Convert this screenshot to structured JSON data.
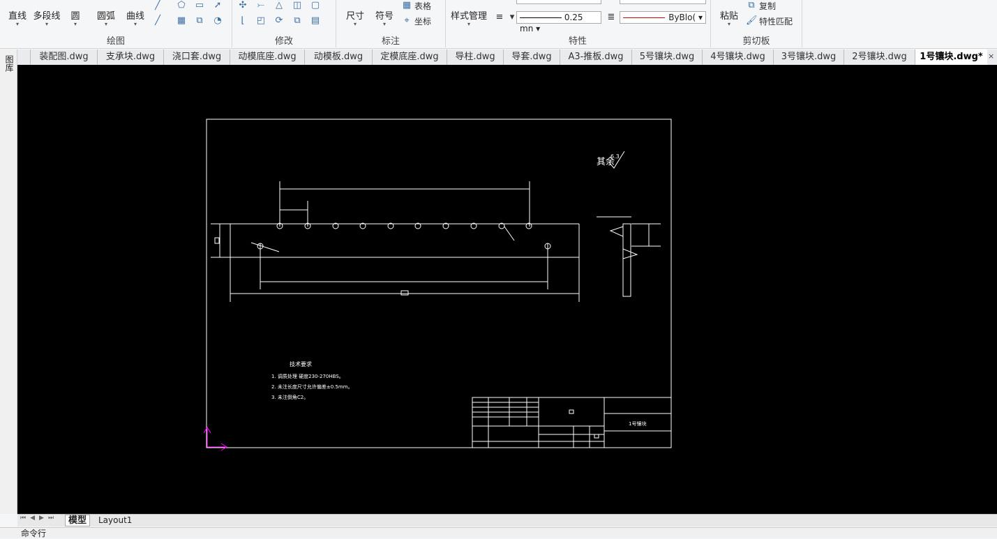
{
  "ribbon": {
    "draw": {
      "title": "绘图",
      "line": "直线",
      "polyline": "多段线",
      "circle": "圆",
      "arc": "圆弧",
      "curve": "曲线"
    },
    "modify": {
      "title": "修改"
    },
    "annotate": {
      "title": "标注",
      "dimension": "尺寸",
      "symbol": "符号",
      "table": "表格",
      "coord": "坐标"
    },
    "style": {
      "label": "样式管理"
    },
    "props": {
      "title": "特性",
      "lineweight": "0.25 mn",
      "linetype": "ByBlo("
    },
    "clipboard": {
      "title": "剪切板",
      "paste": "粘贴",
      "copy": "复制",
      "match": "特性匹配"
    }
  },
  "tabs": [
    "装配图.dwg",
    "支承块.dwg",
    "浇口套.dwg",
    "动模底座.dwg",
    "动模板.dwg",
    "定模底座.dwg",
    "导柱.dwg",
    "导套.dwg",
    "A3-推板.dwg",
    "5号镶块.dwg",
    "4号镶块.dwg",
    "3号镶块.dwg",
    "2号镶块.dwg",
    "1号镶块.dwg*"
  ],
  "leftbar": {
    "label": "图库"
  },
  "drawing": {
    "roughness": "其余",
    "roughness_val": "6.3",
    "req_title": "技术要求",
    "req1": "1. 调质处理 硬度230-270HBS。",
    "req2": "2. 未注长度尺寸允许偏差±0.5mm。",
    "req3": "3. 未注倒角C2。",
    "part_name": "1号镶块"
  },
  "layoutbar": {
    "model": "模型",
    "layout1": "Layout1"
  },
  "cmd": {
    "label": "命令行"
  },
  "colors": {
    "canvas": "#000000",
    "accent": "#ff00ff"
  }
}
